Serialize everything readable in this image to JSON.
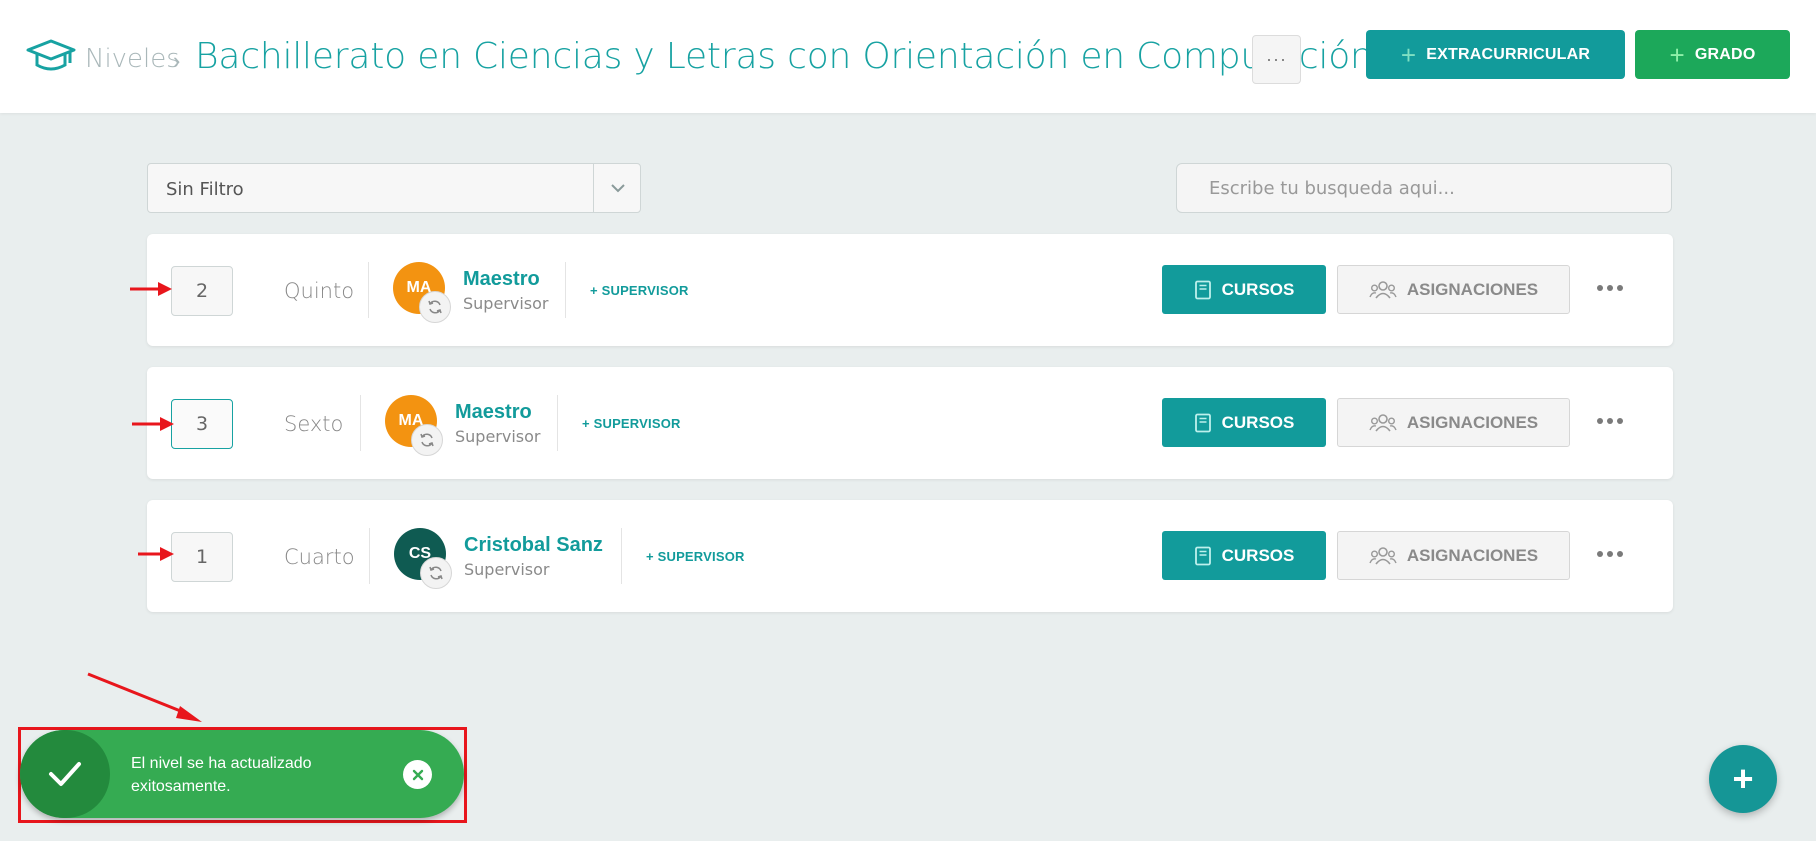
{
  "header": {
    "breadcrumb_root": "Niveles",
    "breadcrumb_sep": "›",
    "title": "Bachillerato en Ciencias y Letras con Orientación en Computación",
    "more_label": "···",
    "btn_extracurricular": "EXTRACURRICULAR",
    "btn_grado": "GRADO",
    "plus": "+"
  },
  "filter": {
    "selected": "Sin Filtro"
  },
  "search": {
    "placeholder": "Escribe tu busqueda aqui..."
  },
  "rows": [
    {
      "order": "2",
      "level": "Quinto",
      "avatar_initials": "MA",
      "avatar_color": "#f39311",
      "teacher_name": "Maestro",
      "teacher_role": "Supervisor",
      "add_supervisor": "+ SUPERVISOR",
      "btn_cursos": "CURSOS",
      "btn_asignaciones": "ASIGNACIONES"
    },
    {
      "order": "3",
      "level": "Sexto",
      "avatar_initials": "MA",
      "avatar_color": "#f39311",
      "teacher_name": "Maestro",
      "teacher_role": "Supervisor",
      "add_supervisor": "+ SUPERVISOR",
      "btn_cursos": "CURSOS",
      "btn_asignaciones": "ASIGNACIONES"
    },
    {
      "order": "1",
      "level": "Cuarto",
      "avatar_initials": "CS",
      "avatar_color": "#0f5b52",
      "teacher_name": "Cristobal Sanz",
      "teacher_role": "Supervisor",
      "add_supervisor": "+ SUPERVISOR",
      "btn_cursos": "CURSOS",
      "btn_asignaciones": "ASIGNACIONES"
    }
  ],
  "toast": {
    "message": "El nivel se ha actualizado exitosamente."
  },
  "fab": {
    "label": "+"
  },
  "colors": {
    "brand_teal": "#129b9b",
    "success_green": "#1ca85a",
    "toast_green": "#35ab52",
    "annotation_red": "#e8161c"
  }
}
